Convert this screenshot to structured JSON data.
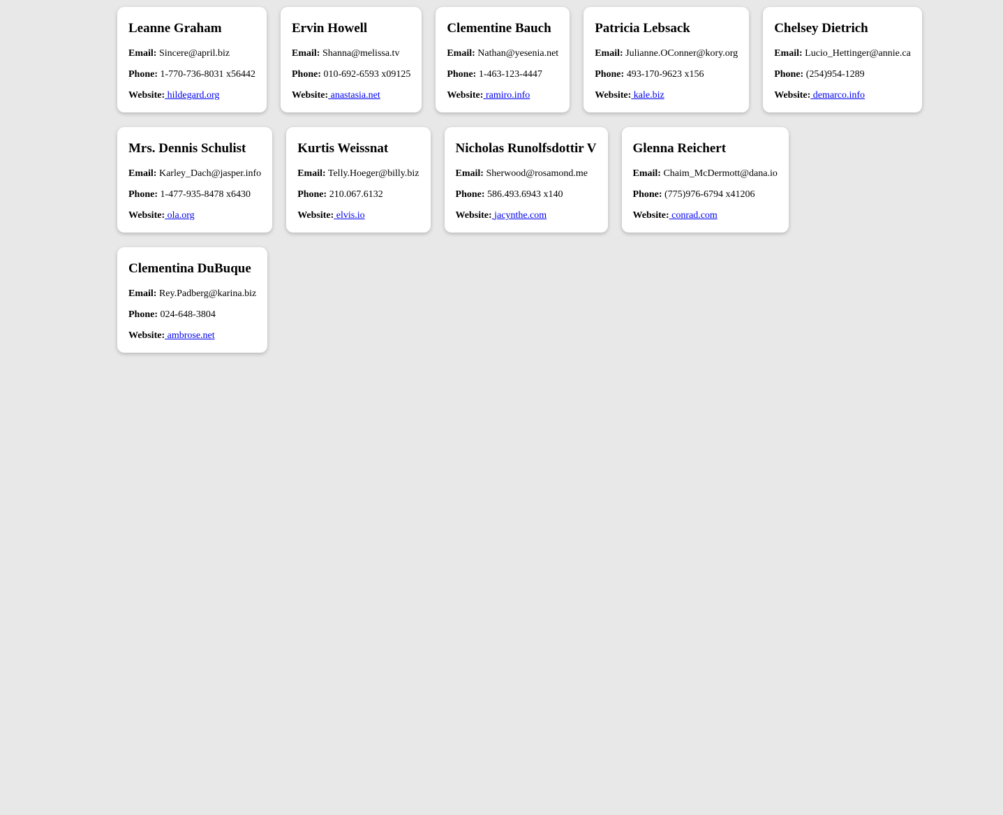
{
  "labels": {
    "email": "Email:",
    "phone": "Phone:",
    "website": "Website:"
  },
  "users": [
    {
      "name": "Leanne Graham",
      "email": "Sincere@april.biz",
      "phone": "1-770-736-8031 x56442",
      "website": "hildegard.org"
    },
    {
      "name": "Ervin Howell",
      "email": "Shanna@melissa.tv",
      "phone": "010-692-6593 x09125",
      "website": "anastasia.net"
    },
    {
      "name": "Clementine Bauch",
      "email": "Nathan@yesenia.net",
      "phone": "1-463-123-4447",
      "website": "ramiro.info"
    },
    {
      "name": "Patricia Lebsack",
      "email": "Julianne.OConner@kory.org",
      "phone": "493-170-9623 x156",
      "website": "kale.biz"
    },
    {
      "name": "Chelsey Dietrich",
      "email": "Lucio_Hettinger@annie.ca",
      "phone": "(254)954-1289",
      "website": "demarco.info"
    },
    {
      "name": "Mrs. Dennis Schulist",
      "email": "Karley_Dach@jasper.info",
      "phone": "1-477-935-8478 x6430",
      "website": "ola.org"
    },
    {
      "name": "Kurtis Weissnat",
      "email": "Telly.Hoeger@billy.biz",
      "phone": "210.067.6132",
      "website": "elvis.io"
    },
    {
      "name": "Nicholas Runolfsdottir V",
      "email": "Sherwood@rosamond.me",
      "phone": "586.493.6943 x140",
      "website": "jacynthe.com"
    },
    {
      "name": "Glenna Reichert",
      "email": "Chaim_McDermott@dana.io",
      "phone": "(775)976-6794 x41206",
      "website": "conrad.com"
    },
    {
      "name": "Clementina DuBuque",
      "email": "Rey.Padberg@karina.biz",
      "phone": "024-648-3804",
      "website": "ambrose.net"
    }
  ]
}
